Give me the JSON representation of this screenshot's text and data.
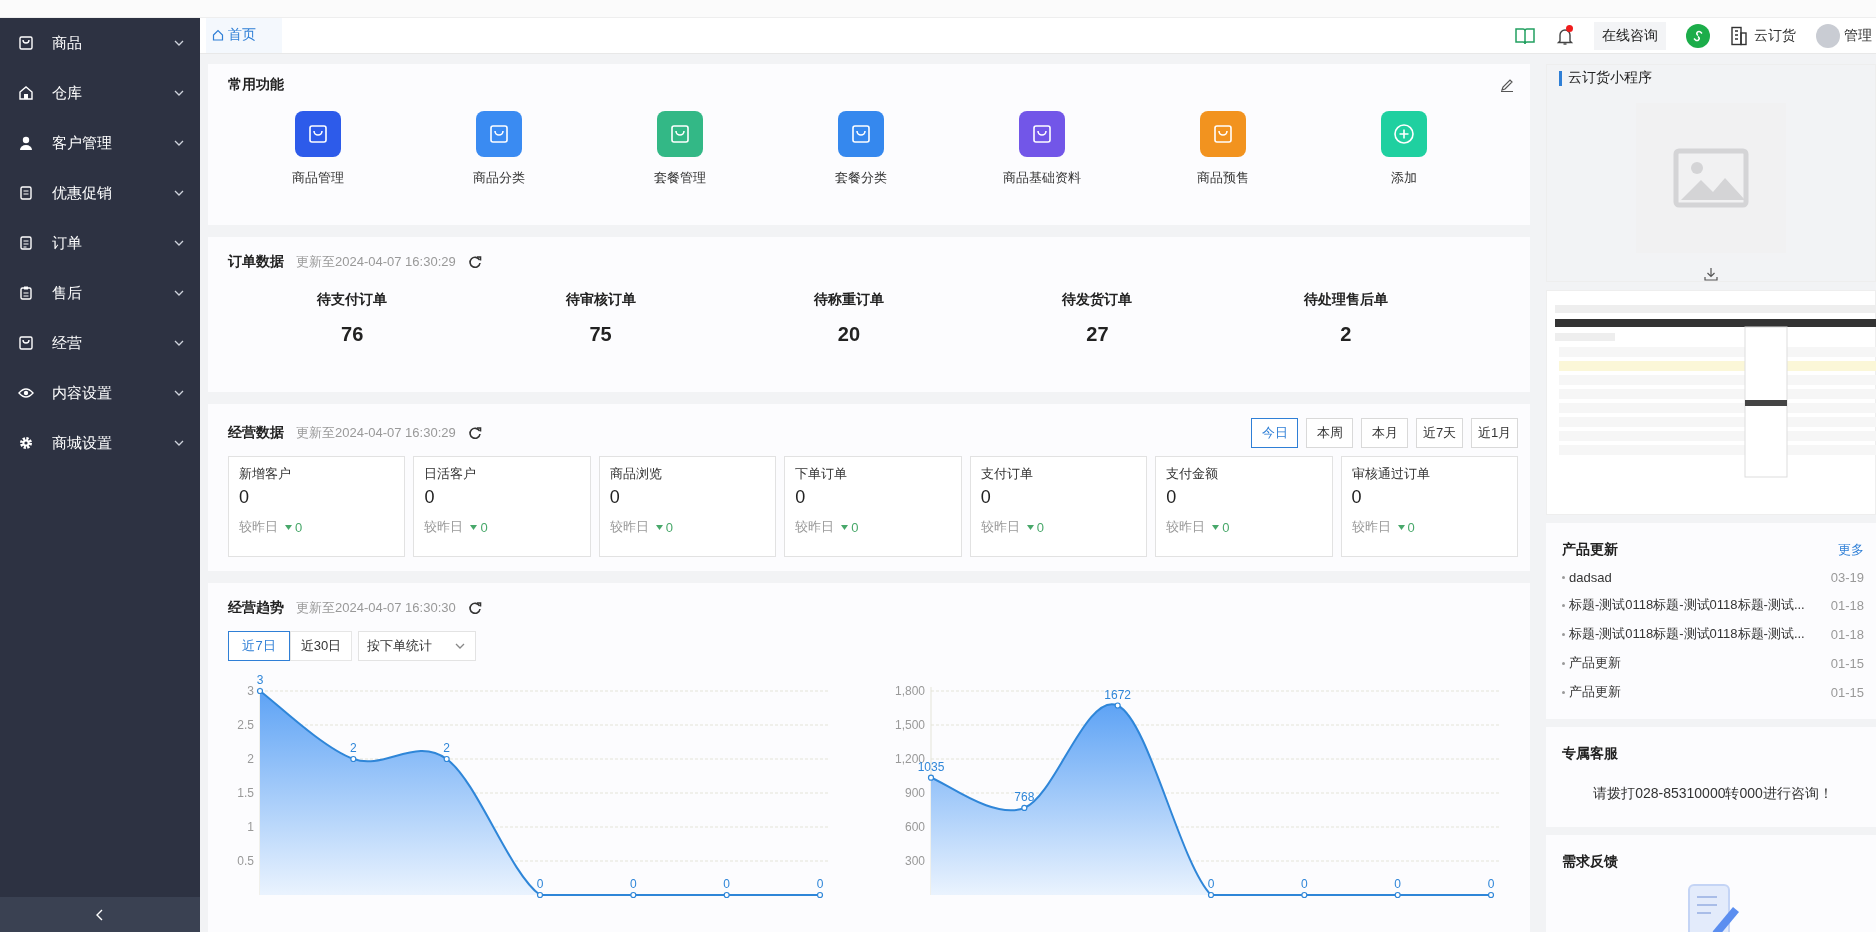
{
  "sidebar": {
    "items": [
      {
        "label": "商品",
        "expanded": false
      },
      {
        "label": "仓库",
        "expanded": false
      },
      {
        "label": "客户管理",
        "expanded": false
      },
      {
        "label": "优惠促销",
        "expanded": false
      },
      {
        "label": "订单",
        "expanded": false
      },
      {
        "label": "售后",
        "expanded": false
      },
      {
        "label": "经营",
        "expanded": false
      },
      {
        "label": "内容设置",
        "expanded": false
      },
      {
        "label": "商城设置",
        "expanded": false
      }
    ]
  },
  "tabs": [
    {
      "label": "首页",
      "selected": true
    }
  ],
  "header": {
    "notification_dot": true,
    "consult_button": "在线咨询",
    "product_name": "云订货",
    "user_name": "管理"
  },
  "common_functions": {
    "title": "常用功能",
    "items": [
      {
        "label": "商品管理",
        "kind": "bag",
        "color": "#2d5bea"
      },
      {
        "label": "商品分类",
        "kind": "bag",
        "color": "#3a8bf2"
      },
      {
        "label": "套餐管理",
        "kind": "bag",
        "color": "#33b886"
      },
      {
        "label": "套餐分类",
        "kind": "bag",
        "color": "#3588ee"
      },
      {
        "label": "商品基础资料",
        "kind": "bag",
        "color": "#7256e8"
      },
      {
        "label": "商品预售",
        "kind": "bag",
        "color": "#f2931f"
      },
      {
        "label": "添加",
        "kind": "add",
        "color": "#1fd0a0"
      }
    ]
  },
  "order_data": {
    "title": "订单数据",
    "updated": "更新至2024-04-07 16:30:29",
    "stats": [
      {
        "label": "待支付订单",
        "value": "76"
      },
      {
        "label": "待审核订单",
        "value": "75"
      },
      {
        "label": "待称重订单",
        "value": "20"
      },
      {
        "label": "待发货订单",
        "value": "27"
      },
      {
        "label": "待处理售后单",
        "value": "2"
      }
    ]
  },
  "business_data": {
    "title": "经营数据",
    "updated": "更新至2024-04-07 16:30:29",
    "periods": [
      {
        "label": "今日",
        "selected": true
      },
      {
        "label": "本周",
        "selected": false
      },
      {
        "label": "本月",
        "selected": false
      },
      {
        "label": "近7天",
        "selected": false
      },
      {
        "label": "近1月",
        "selected": false
      }
    ],
    "metrics": [
      {
        "label": "新增客户",
        "value": "0",
        "compare_label": "较昨日",
        "decreased": true,
        "change": "0"
      },
      {
        "label": "日活客户",
        "value": "0",
        "compare_label": "较昨日",
        "decreased": true,
        "change": "0"
      },
      {
        "label": "商品浏览",
        "value": "0",
        "compare_label": "较昨日",
        "decreased": true,
        "change": "0"
      },
      {
        "label": "下单订单",
        "value": "0",
        "compare_label": "较昨日",
        "decreased": true,
        "change": "0"
      },
      {
        "label": "支付订单",
        "value": "0",
        "compare_label": "较昨日",
        "decreased": true,
        "change": "0"
      },
      {
        "label": "支付金额",
        "value": "0",
        "compare_label": "较昨日",
        "decreased": true,
        "change": "0"
      },
      {
        "label": "审核通过订单",
        "value": "0",
        "compare_label": "较昨日",
        "decreased": true,
        "change": "0"
      }
    ]
  },
  "business_trend": {
    "title": "经营趋势",
    "updated": "更新至2024-04-07 16:30:30",
    "ranges": [
      {
        "label": "近7日",
        "selected": true
      },
      {
        "label": "近30日",
        "selected": false
      }
    ],
    "stat_select": {
      "value": "按下单统计"
    },
    "charts": [
      {
        "chart_data": {
          "type": "area",
          "grid": true,
          "ylim": [
            0,
            3
          ],
          "yticks": [
            0.5,
            1,
            1.5,
            2,
            2.5,
            3
          ],
          "data_labels": true,
          "series": [
            {
              "color": "#2f86d8",
              "values": [
                3,
                2,
                2,
                0,
                0,
                0,
                0
              ]
            }
          ]
        }
      },
      {
        "chart_data": {
          "type": "area",
          "grid": true,
          "ylim": [
            0,
            1800
          ],
          "yticks": [
            {
              "value": 300,
              "label": "300"
            },
            {
              "value": 600,
              "label": "600"
            },
            {
              "value": 900,
              "label": "900"
            },
            {
              "value": 1200,
              "label": "1,200"
            },
            {
              "value": 1500,
              "label": "1,500"
            },
            {
              "value": 1800,
              "label": "1,800"
            }
          ],
          "data_labels": true,
          "series": [
            {
              "color": "#2f86d8",
              "values": [
                1035,
                768,
                1672,
                0,
                0,
                0,
                0
              ]
            }
          ]
        }
      }
    ]
  },
  "right_panel": {
    "mini_program": {
      "title": "云订货小程序"
    },
    "product_updates": {
      "title": "产品更新",
      "more_link": "更多",
      "items": [
        {
          "title": "dadsad",
          "date": "03-19"
        },
        {
          "title": "标题-测试0118标题-测试0118标题-测试...",
          "date": "01-18"
        },
        {
          "title": "标题-测试0118标题-测试0118标题-测试...",
          "date": "01-18"
        },
        {
          "title": "产品更新",
          "date": "01-15"
        },
        {
          "title": "产品更新",
          "date": "01-15"
        }
      ]
    },
    "customer_service": {
      "title": "专属客服",
      "message": "请拨打028-85310000转000进行咨询！"
    },
    "feedback": {
      "title": "需求反馈"
    }
  }
}
